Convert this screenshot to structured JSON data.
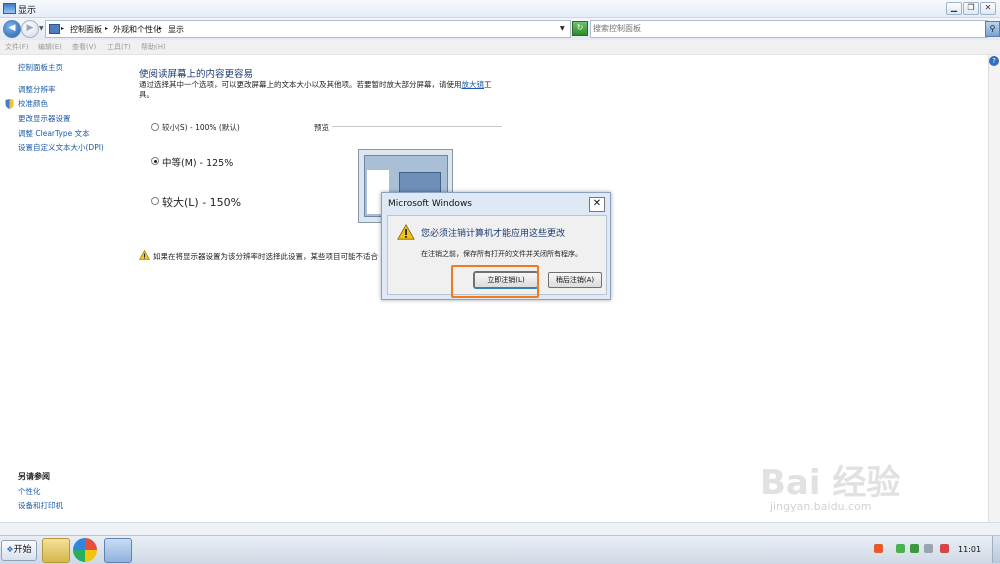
{
  "window": {
    "title": "显示",
    "controls": {
      "minimize": "▁",
      "restore": "❐",
      "close": "✕"
    }
  },
  "address": {
    "breadcrumbs": [
      "控制面板",
      "外观和个性化",
      "显示"
    ],
    "search_placeholder": "搜索控制面板"
  },
  "menu": [
    "文件(F)",
    "编辑(E)",
    "查看(V)",
    "工具(T)",
    "帮助(H)"
  ],
  "sidebar": {
    "home": "控制面板主页",
    "links": [
      "调整分辨率",
      "校准颜色",
      "更改显示器设置",
      "调整 ClearType 文本",
      "设置自定义文本大小(DPI)"
    ],
    "see_also_heading": "另请参阅",
    "see_also": [
      "个性化",
      "设备和打印机"
    ]
  },
  "main": {
    "heading": "使阅读屏幕上的内容更容易",
    "description_prefix": "通过选择其中一个选项，可以更改屏幕上的文本大小以及其他项。若要暂时放大部分屏幕，请使用",
    "description_link": "放大镜",
    "description_suffix": "工具。",
    "options": [
      {
        "label": "较小(S) - 100% (默认)",
        "checked": false
      },
      {
        "label": "中等(M) - 125%",
        "checked": true
      },
      {
        "label": "较大(L) - 150%",
        "checked": false
      }
    ],
    "preview_label": "预览",
    "warning": "如果在将显示器设置为该分辨率时选择此设置，某些项目可能不适合"
  },
  "dialog": {
    "title": "Microsoft Windows",
    "close": "✕",
    "message": "您必须注销计算机才能应用这些更改",
    "submessage": "在注销之前，保存所有打开的文件并关闭所有程序。",
    "btn_now": "立即注销(L)",
    "btn_later": "稍后注销(A)"
  },
  "taskbar": {
    "start": "开始",
    "time": "11:01"
  },
  "watermark": {
    "main": "Bai 经验",
    "sub": "jingyan.baidu.com"
  },
  "colors": {
    "link": "#1d5aa8",
    "heading": "#1e3a70",
    "highlight": "#f07a1c"
  }
}
